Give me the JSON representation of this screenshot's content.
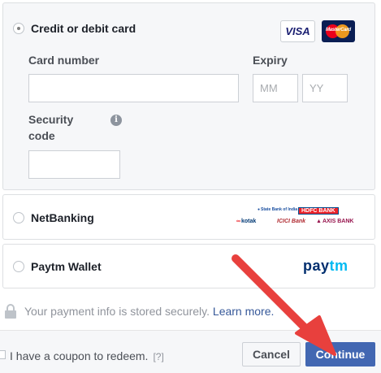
{
  "card_option": {
    "label": "Credit or debit card",
    "selected": true,
    "card_number_label": "Card number",
    "card_number_value": "",
    "expiry_label": "Expiry",
    "expiry_month_placeholder": "MM",
    "expiry_year_placeholder": "YY",
    "security_label_line1": "Security",
    "security_label_line2": "code",
    "security_value": "",
    "info_icon_glyph": "i",
    "logos": {
      "visa_text": "VISA",
      "mastercard_text": "MasterCard"
    }
  },
  "netbanking_option": {
    "label": "NetBanking",
    "selected": false,
    "bank_logos": {
      "sbi": "State Bank of India",
      "hdfc": "HDFC BANK",
      "kotak": "kotak",
      "icici": "ICICI Bank",
      "axis": "AXIS BANK"
    }
  },
  "paytm_option": {
    "label": "Paytm Wallet",
    "selected": false,
    "logo_pay": "pay",
    "logo_tm": "tm"
  },
  "security_note": {
    "text": "Your payment info is stored securely.",
    "link": "Learn more."
  },
  "footer": {
    "coupon_label": "I have a coupon to redeem.",
    "coupon_help": "[?]",
    "coupon_checked": false,
    "cancel_label": "Cancel",
    "continue_label": "Continue"
  },
  "colors": {
    "primary_button": "#4267b2",
    "link": "#365899",
    "annotation_arrow": "#e8403d"
  }
}
